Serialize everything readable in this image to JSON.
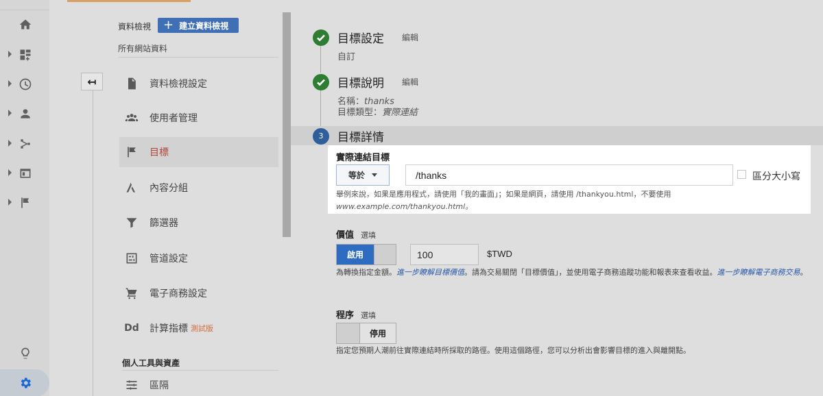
{
  "rail": {
    "items": [
      "home-icon",
      "dashboard-icon",
      "clock-icon",
      "person-icon",
      "acquisition-icon",
      "behavior-icon",
      "flag-icon"
    ],
    "bottom": [
      "lightbulb-icon",
      "gear-icon"
    ]
  },
  "view": {
    "label": "資料檢視",
    "create_button": "建立資料檢視",
    "name": "所有網站資料"
  },
  "menu": {
    "items": [
      {
        "label": "資料檢視設定",
        "icon": "document-icon"
      },
      {
        "label": "使用者管理",
        "icon": "users-icon"
      },
      {
        "label": "目標",
        "icon": "flag-icon"
      },
      {
        "label": "內容分組",
        "icon": "content-group-icon"
      },
      {
        "label": "篩選器",
        "icon": "filter-icon"
      },
      {
        "label": "管道設定",
        "icon": "channel-icon"
      },
      {
        "label": "電子商務設定",
        "icon": "cart-icon"
      },
      {
        "label": "計算指標",
        "icon": "dd-icon",
        "badge": "測試版"
      }
    ],
    "section_head": "個人工具與資產",
    "section_items": [
      {
        "label": "區隔",
        "icon": "segment-icon"
      }
    ]
  },
  "steps": {
    "s1": {
      "title": "目標設定",
      "edit": "編輯",
      "sub": "自訂"
    },
    "s2": {
      "title": "目標說明",
      "edit": "編輯",
      "name_label": "名稱：",
      "name_value": "thanks",
      "type_label": "目標類型：",
      "type_value": "實際連結"
    },
    "s3": {
      "number": "3",
      "title": "目標詳情"
    }
  },
  "destination": {
    "title": "實際連結目標",
    "match_type": "等於",
    "url": "/thanks",
    "case_label": "區分大小寫",
    "help_line1": "舉例來說，如果是應用程式，請使用「我的畫面」；如果是網頁，請使用 /thankyou.html，不要使用",
    "help_line2": "www.example.com/thankyou.html。"
  },
  "value": {
    "label": "價值",
    "optional": "選填",
    "toggle_on": "啟用",
    "amount": "100",
    "currency": "$TWD",
    "help_a": "為轉換指定金額。",
    "help_link1": "進一步瞭解目標價值",
    "help_b": "。請為交易關閉「目標價值」，並使用電子商務追蹤功能和報表來查看收益。",
    "help_link2": "進一步瞭解電子商務交易",
    "help_c": "。"
  },
  "funnel": {
    "label": "程序",
    "optional": "選填",
    "toggle_off": "停用",
    "help": "指定您預期人潮前往實際連結時所採取的路徑。使用這個路徑，您可以分析出會影響目標的進入與離開點。"
  },
  "colors": {
    "accent_blue": "#2d6cc0",
    "check_green": "#2e7d32",
    "active_red": "#b0463a"
  }
}
